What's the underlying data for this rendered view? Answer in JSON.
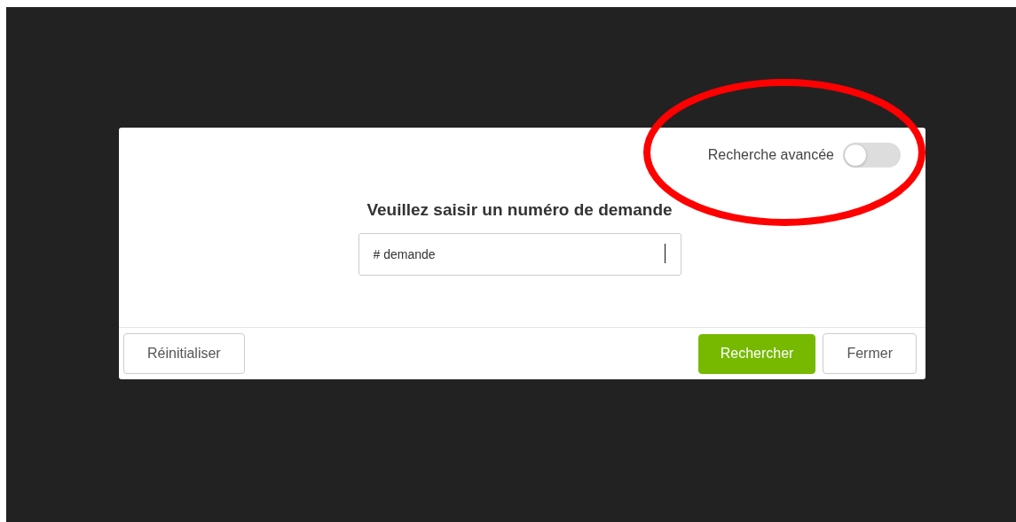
{
  "dialog": {
    "advanced_search": {
      "label": "Recherche avancée",
      "on": false
    },
    "title": "Veuillez saisir un numéro de demande",
    "request_field": {
      "placeholder": "# demande"
    },
    "buttons": [
      {
        "label": "Réinitialiser",
        "kind": "secondary"
      },
      {
        "label": "Rechercher",
        "kind": "primary"
      },
      {
        "label": "Fermer",
        "kind": "secondary"
      }
    ]
  }
}
